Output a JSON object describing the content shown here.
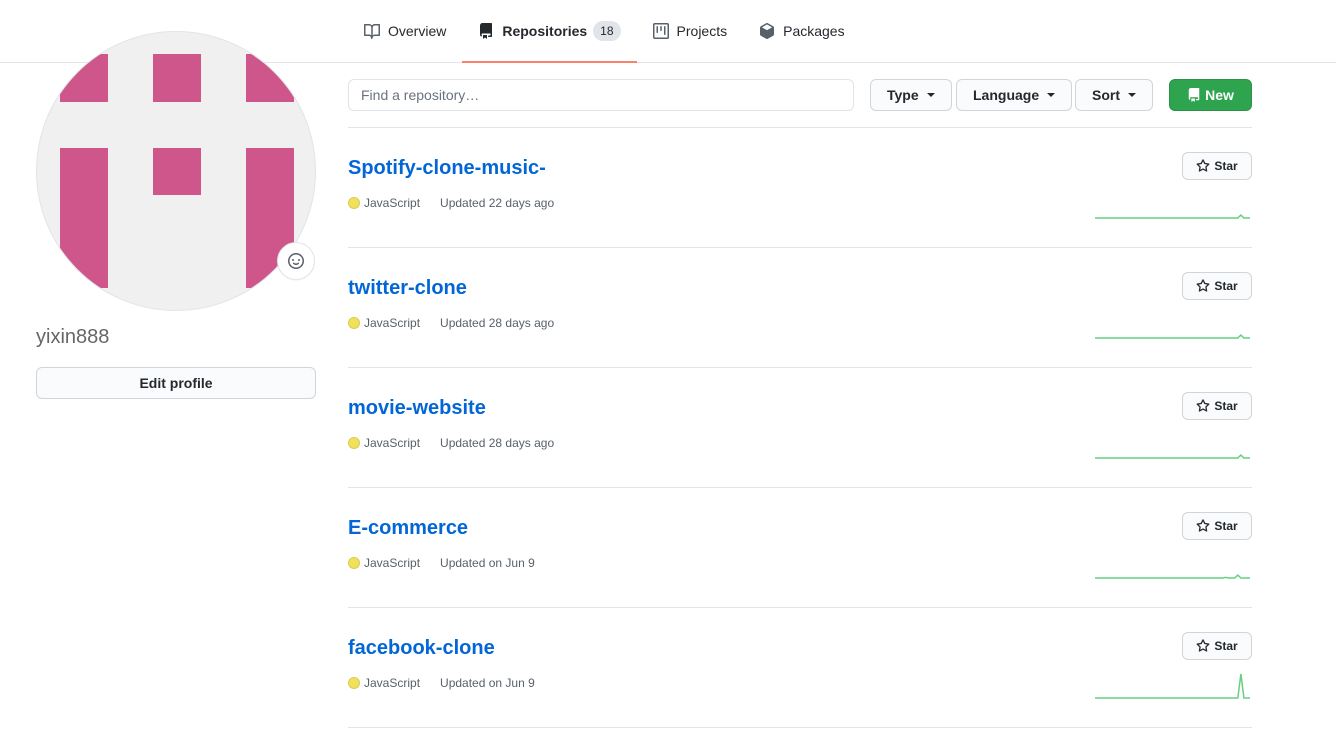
{
  "nav": {
    "tabs": [
      {
        "label": "Overview",
        "icon": "book-icon"
      },
      {
        "label": "Repositories",
        "icon": "repo-icon",
        "count": "18",
        "selected": true
      },
      {
        "label": "Projects",
        "icon": "project-icon"
      },
      {
        "label": "Packages",
        "icon": "package-icon"
      }
    ]
  },
  "profile": {
    "username": "yixin888",
    "edit_label": "Edit profile",
    "avatar_color": "#cf568a"
  },
  "filters": {
    "search_placeholder": "Find a repository…",
    "type_label": "Type",
    "language_label": "Language",
    "sort_label": "Sort",
    "new_label": "New"
  },
  "colors": {
    "accent_tab": "#f9826c",
    "link": "#0366d6",
    "new_button": "#2ea44f",
    "javascript": "#f1e05a",
    "sparkline": "#40c463"
  },
  "repos": [
    {
      "name": "Spotify-clone-music-",
      "language": "JavaScript",
      "updated": "Updated 22 days ago",
      "star_label": "Star",
      "activity": [
        0,
        0,
        0,
        0,
        0,
        0,
        0,
        0,
        0,
        0,
        0,
        0,
        0,
        0,
        0,
        0,
        0,
        0,
        0,
        0,
        0,
        0,
        0,
        0,
        0,
        0,
        0,
        0,
        0,
        0,
        0,
        0,
        0,
        0,
        0,
        0,
        0,
        0,
        0,
        0,
        0,
        0,
        0,
        0,
        0,
        0,
        0,
        0,
        1,
        0,
        0,
        0
      ]
    },
    {
      "name": "twitter-clone",
      "language": "JavaScript",
      "updated": "Updated 28 days ago",
      "star_label": "Star",
      "activity": [
        0,
        0,
        0,
        0,
        0,
        0,
        0,
        0,
        0,
        0,
        0,
        0,
        0,
        0,
        0,
        0,
        0,
        0,
        0,
        0,
        0,
        0,
        0,
        0,
        0,
        0,
        0,
        0,
        0,
        0,
        0,
        0,
        0,
        0,
        0,
        0,
        0,
        0,
        0,
        0,
        0,
        0,
        0,
        0,
        0,
        0,
        0,
        0,
        1,
        0,
        0,
        0
      ]
    },
    {
      "name": "movie-website",
      "language": "JavaScript",
      "updated": "Updated 28 days ago",
      "star_label": "Star",
      "activity": [
        0,
        0,
        0,
        0,
        0,
        0,
        0,
        0,
        0,
        0,
        0,
        0,
        0,
        0,
        0,
        0,
        0,
        0,
        0,
        0,
        0,
        0,
        0,
        0,
        0,
        0,
        0,
        0,
        0,
        0,
        0,
        0,
        0,
        0,
        0,
        0,
        0,
        0,
        0,
        0,
        0,
        0,
        0,
        0,
        0,
        0,
        0,
        0,
        1,
        0,
        0,
        0
      ]
    },
    {
      "name": "E-commerce",
      "language": "JavaScript",
      "updated": "Updated on Jun 9",
      "star_label": "Star",
      "activity": [
        0,
        0,
        0,
        0,
        0,
        0,
        0,
        0,
        0,
        0,
        0,
        0,
        0,
        0,
        0,
        0,
        0,
        0,
        0,
        0,
        0,
        0,
        0,
        0,
        0,
        0,
        0,
        0,
        0,
        0,
        0,
        0,
        0,
        0,
        0,
        0,
        0,
        0,
        0,
        0,
        0,
        0,
        0,
        0.2,
        0,
        0,
        0,
        1,
        0,
        0,
        0,
        0
      ]
    },
    {
      "name": "facebook-clone",
      "language": "JavaScript",
      "updated": "Updated on Jun 9",
      "star_label": "Star",
      "activity": [
        0,
        0,
        0,
        0,
        0,
        0,
        0,
        0,
        0,
        0,
        0,
        0,
        0,
        0,
        0,
        0,
        0,
        0,
        0,
        0,
        0,
        0,
        0,
        0,
        0,
        0,
        0,
        0,
        0,
        0,
        0,
        0,
        0,
        0,
        0,
        0,
        0,
        0,
        0,
        0,
        0,
        0,
        0,
        0,
        0,
        0,
        0,
        0,
        8,
        0,
        0,
        0
      ]
    }
  ]
}
